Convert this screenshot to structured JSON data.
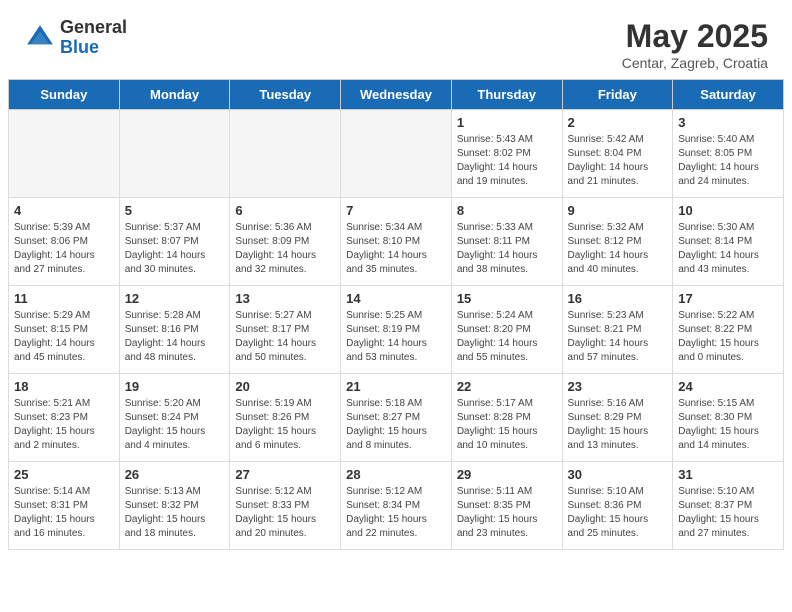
{
  "logo": {
    "general": "General",
    "blue": "Blue"
  },
  "title": "May 2025",
  "location": "Centar, Zagreb, Croatia",
  "headers": [
    "Sunday",
    "Monday",
    "Tuesday",
    "Wednesday",
    "Thursday",
    "Friday",
    "Saturday"
  ],
  "weeks": [
    [
      {
        "day": "",
        "info": ""
      },
      {
        "day": "",
        "info": ""
      },
      {
        "day": "",
        "info": ""
      },
      {
        "day": "",
        "info": ""
      },
      {
        "day": "1",
        "info": "Sunrise: 5:43 AM\nSunset: 8:02 PM\nDaylight: 14 hours\nand 19 minutes."
      },
      {
        "day": "2",
        "info": "Sunrise: 5:42 AM\nSunset: 8:04 PM\nDaylight: 14 hours\nand 21 minutes."
      },
      {
        "day": "3",
        "info": "Sunrise: 5:40 AM\nSunset: 8:05 PM\nDaylight: 14 hours\nand 24 minutes."
      }
    ],
    [
      {
        "day": "4",
        "info": "Sunrise: 5:39 AM\nSunset: 8:06 PM\nDaylight: 14 hours\nand 27 minutes."
      },
      {
        "day": "5",
        "info": "Sunrise: 5:37 AM\nSunset: 8:07 PM\nDaylight: 14 hours\nand 30 minutes."
      },
      {
        "day": "6",
        "info": "Sunrise: 5:36 AM\nSunset: 8:09 PM\nDaylight: 14 hours\nand 32 minutes."
      },
      {
        "day": "7",
        "info": "Sunrise: 5:34 AM\nSunset: 8:10 PM\nDaylight: 14 hours\nand 35 minutes."
      },
      {
        "day": "8",
        "info": "Sunrise: 5:33 AM\nSunset: 8:11 PM\nDaylight: 14 hours\nand 38 minutes."
      },
      {
        "day": "9",
        "info": "Sunrise: 5:32 AM\nSunset: 8:12 PM\nDaylight: 14 hours\nand 40 minutes."
      },
      {
        "day": "10",
        "info": "Sunrise: 5:30 AM\nSunset: 8:14 PM\nDaylight: 14 hours\nand 43 minutes."
      }
    ],
    [
      {
        "day": "11",
        "info": "Sunrise: 5:29 AM\nSunset: 8:15 PM\nDaylight: 14 hours\nand 45 minutes."
      },
      {
        "day": "12",
        "info": "Sunrise: 5:28 AM\nSunset: 8:16 PM\nDaylight: 14 hours\nand 48 minutes."
      },
      {
        "day": "13",
        "info": "Sunrise: 5:27 AM\nSunset: 8:17 PM\nDaylight: 14 hours\nand 50 minutes."
      },
      {
        "day": "14",
        "info": "Sunrise: 5:25 AM\nSunset: 8:19 PM\nDaylight: 14 hours\nand 53 minutes."
      },
      {
        "day": "15",
        "info": "Sunrise: 5:24 AM\nSunset: 8:20 PM\nDaylight: 14 hours\nand 55 minutes."
      },
      {
        "day": "16",
        "info": "Sunrise: 5:23 AM\nSunset: 8:21 PM\nDaylight: 14 hours\nand 57 minutes."
      },
      {
        "day": "17",
        "info": "Sunrise: 5:22 AM\nSunset: 8:22 PM\nDaylight: 15 hours\nand 0 minutes."
      }
    ],
    [
      {
        "day": "18",
        "info": "Sunrise: 5:21 AM\nSunset: 8:23 PM\nDaylight: 15 hours\nand 2 minutes."
      },
      {
        "day": "19",
        "info": "Sunrise: 5:20 AM\nSunset: 8:24 PM\nDaylight: 15 hours\nand 4 minutes."
      },
      {
        "day": "20",
        "info": "Sunrise: 5:19 AM\nSunset: 8:26 PM\nDaylight: 15 hours\nand 6 minutes."
      },
      {
        "day": "21",
        "info": "Sunrise: 5:18 AM\nSunset: 8:27 PM\nDaylight: 15 hours\nand 8 minutes."
      },
      {
        "day": "22",
        "info": "Sunrise: 5:17 AM\nSunset: 8:28 PM\nDaylight: 15 hours\nand 10 minutes."
      },
      {
        "day": "23",
        "info": "Sunrise: 5:16 AM\nSunset: 8:29 PM\nDaylight: 15 hours\nand 13 minutes."
      },
      {
        "day": "24",
        "info": "Sunrise: 5:15 AM\nSunset: 8:30 PM\nDaylight: 15 hours\nand 14 minutes."
      }
    ],
    [
      {
        "day": "25",
        "info": "Sunrise: 5:14 AM\nSunset: 8:31 PM\nDaylight: 15 hours\nand 16 minutes."
      },
      {
        "day": "26",
        "info": "Sunrise: 5:13 AM\nSunset: 8:32 PM\nDaylight: 15 hours\nand 18 minutes."
      },
      {
        "day": "27",
        "info": "Sunrise: 5:12 AM\nSunset: 8:33 PM\nDaylight: 15 hours\nand 20 minutes."
      },
      {
        "day": "28",
        "info": "Sunrise: 5:12 AM\nSunset: 8:34 PM\nDaylight: 15 hours\nand 22 minutes."
      },
      {
        "day": "29",
        "info": "Sunrise: 5:11 AM\nSunset: 8:35 PM\nDaylight: 15 hours\nand 23 minutes."
      },
      {
        "day": "30",
        "info": "Sunrise: 5:10 AM\nSunset: 8:36 PM\nDaylight: 15 hours\nand 25 minutes."
      },
      {
        "day": "31",
        "info": "Sunrise: 5:10 AM\nSunset: 8:37 PM\nDaylight: 15 hours\nand 27 minutes."
      }
    ]
  ]
}
